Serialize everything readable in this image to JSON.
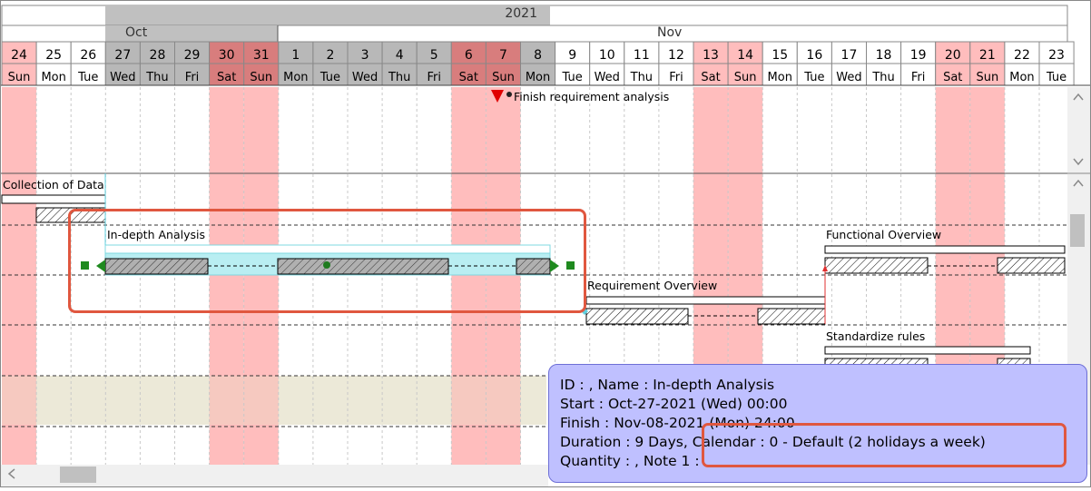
{
  "header": {
    "year": "2021",
    "months": [
      "Oct",
      "Nov"
    ],
    "days": [
      {
        "d": "24",
        "w": "Sun"
      },
      {
        "d": "25",
        "w": "Mon"
      },
      {
        "d": "26",
        "w": "Tue"
      },
      {
        "d": "27",
        "w": "Wed"
      },
      {
        "d": "28",
        "w": "Thu"
      },
      {
        "d": "29",
        "w": "Fri"
      },
      {
        "d": "30",
        "w": "Sat"
      },
      {
        "d": "31",
        "w": "Sun"
      },
      {
        "d": "1",
        "w": "Mon"
      },
      {
        "d": "2",
        "w": "Tue"
      },
      {
        "d": "3",
        "w": "Wed"
      },
      {
        "d": "4",
        "w": "Thu"
      },
      {
        "d": "5",
        "w": "Fri"
      },
      {
        "d": "6",
        "w": "Sat"
      },
      {
        "d": "7",
        "w": "Sun"
      },
      {
        "d": "8",
        "w": "Mon"
      },
      {
        "d": "9",
        "w": "Tue"
      },
      {
        "d": "10",
        "w": "Wed"
      },
      {
        "d": "11",
        "w": "Thu"
      },
      {
        "d": "12",
        "w": "Fri"
      },
      {
        "d": "13",
        "w": "Sat"
      },
      {
        "d": "14",
        "w": "Sun"
      },
      {
        "d": "15",
        "w": "Mon"
      },
      {
        "d": "16",
        "w": "Tue"
      },
      {
        "d": "17",
        "w": "Wed"
      },
      {
        "d": "18",
        "w": "Thu"
      },
      {
        "d": "19",
        "w": "Fri"
      },
      {
        "d": "20",
        "w": "Sat"
      },
      {
        "d": "21",
        "w": "Sun"
      },
      {
        "d": "22",
        "w": "Mon"
      },
      {
        "d": "23",
        "w": "Tue"
      }
    ]
  },
  "milestone": {
    "label": "Finish requirement analysis"
  },
  "tasks": [
    {
      "name": "Collection of Data"
    },
    {
      "name": "In-depth Analysis"
    },
    {
      "name": "Requirement Overview"
    },
    {
      "name": "Functional Overview"
    },
    {
      "name": "Standardize rules"
    }
  ],
  "tooltip": {
    "line1": "ID : , Name : In-depth Analysis",
    "line2": "Start : Oct-27-2021 (Wed) 00:00",
    "line3": "Finish : Nov-08-2021 (Mon) 24:00",
    "line4a": "Duration : 9 Days, ",
    "line4b": "Calendar : 0 - Default (2 holidays a week)",
    "line5": "Quantity : , Note 1 :"
  },
  "colors": {
    "holiday": "#ffbdbd",
    "month_bar_oct": "#c0c0c0",
    "selected_task_bg": "#b9eef2",
    "tooltip_bg": "#bfc0ff",
    "highlight": "#e0573f"
  }
}
